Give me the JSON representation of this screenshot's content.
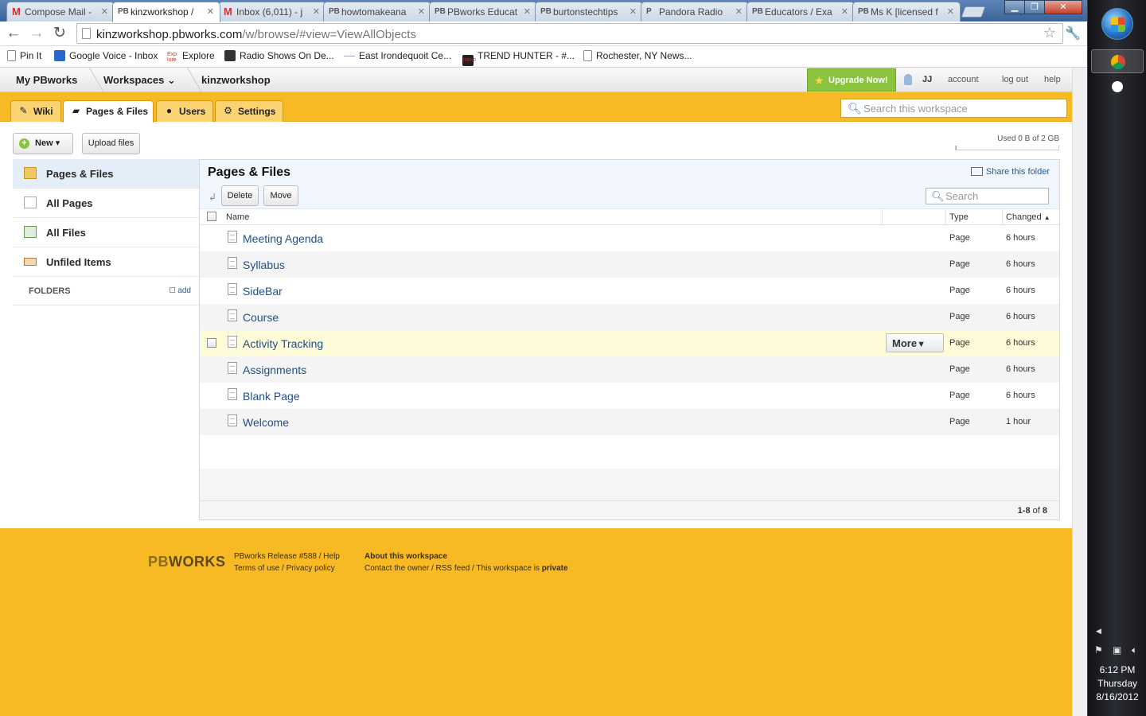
{
  "browser": {
    "tabs": [
      {
        "favicon": "M",
        "title": "Compose Mail -",
        "active": false
      },
      {
        "favicon": "PB",
        "title": "kinzworkshop /",
        "active": true
      },
      {
        "favicon": "M",
        "title": "Inbox (6,011) - j",
        "active": false
      },
      {
        "favicon": "PB",
        "title": "howtomakeana",
        "active": false
      },
      {
        "favicon": "PB",
        "title": "PBworks Educat",
        "active": false
      },
      {
        "favicon": "PB",
        "title": "burtonstechtips",
        "active": false
      },
      {
        "favicon": "P",
        "title": "Pandora Radio",
        "active": false
      },
      {
        "favicon": "PB",
        "title": "Educators / Exa",
        "active": false
      },
      {
        "favicon": "PB",
        "title": "Ms K [licensed f",
        "active": false
      }
    ],
    "url_host": "kinzworkshop.pbworks.com",
    "url_path": "/w/browse/#view=ViewAllObjects",
    "bookmarks": [
      {
        "label": "Pin It",
        "color": "#ffffff"
      },
      {
        "label": "Google Voice - Inbox",
        "color": "#2b66c9"
      },
      {
        "label": "Explore",
        "color": "#d33b2c"
      },
      {
        "label": "Radio Shows On De...",
        "color": "#333333"
      },
      {
        "label": "East Irondequoit Ce...",
        "color": "#9aa7b8"
      },
      {
        "label": "TREND HUNTER - #...",
        "color": "#222222"
      },
      {
        "label": "Rochester, NY News...",
        "color": "#ffffff"
      }
    ],
    "explore_favicon": "Exp\nlore",
    "trend_favicon": "TREND"
  },
  "topnav": {
    "my_pbworks": "My PBworks",
    "workspaces": "Workspaces",
    "workspace_name": "kinzworkshop",
    "upgrade": "Upgrade Now!",
    "user": "JJ",
    "account": "account",
    "logout": "log out",
    "help": "help"
  },
  "tabs": {
    "wiki": "Wiki",
    "pages_files": "Pages & Files",
    "users": "Users",
    "settings": "Settings",
    "search_placeholder": "Search this workspace"
  },
  "actions": {
    "new": "New",
    "upload": "Upload files",
    "storage": "Used 0 B of 2 GB",
    "storage_fraction": 0.0
  },
  "sidebar": {
    "items": [
      {
        "label": "Pages & Files",
        "active": true
      },
      {
        "label": "All Pages",
        "active": false
      },
      {
        "label": "All Files",
        "active": false
      },
      {
        "label": "Unfiled Items",
        "active": false
      }
    ],
    "folders_label": "FOLDERS",
    "add_label": "add"
  },
  "main": {
    "title": "Pages & Files",
    "share": "Share this folder",
    "delete": "Delete",
    "move": "Move",
    "search_placeholder": "Search",
    "columns": {
      "name": "Name",
      "type": "Type",
      "changed": "Changed"
    },
    "rows": [
      {
        "name": "Meeting Agenda",
        "type": "Page",
        "changed": "6 hours"
      },
      {
        "name": "Syllabus",
        "type": "Page",
        "changed": "6 hours"
      },
      {
        "name": "SideBar",
        "type": "Page",
        "changed": "6 hours"
      },
      {
        "name": "Course",
        "type": "Page",
        "changed": "6 hours"
      },
      {
        "name": "Activity Tracking",
        "type": "Page",
        "changed": "6 hours"
      },
      {
        "name": "Assignments",
        "type": "Page",
        "changed": "6 hours"
      },
      {
        "name": "Blank Page",
        "type": "Page",
        "changed": "6 hours"
      },
      {
        "name": "Welcome",
        "type": "Page",
        "changed": "1 hour"
      }
    ],
    "more_label": "More",
    "range_bold": "1-8",
    "range_rest": " of ",
    "range_total": "8"
  },
  "footer": {
    "logo_pb": "PB",
    "logo_works": "WORKS",
    "release": "PBworks Release #588",
    "help": "Help",
    "terms": "Terms of use",
    "privacy": "Privacy policy",
    "about": "About this workspace",
    "contact": "Contact the owner",
    "rss": "RSS feed",
    "private_prefix": "This workspace is",
    "private_word": "private"
  },
  "taskbar": {
    "time": "6:12 PM",
    "day": "Thursday",
    "date": "8/16/2012"
  },
  "colors": {
    "pbworks_yellow": "#f7b924",
    "link_blue": "#1f4f88",
    "upgrade_green": "#8ac43f",
    "row_highlight": "#fdfbd8"
  }
}
